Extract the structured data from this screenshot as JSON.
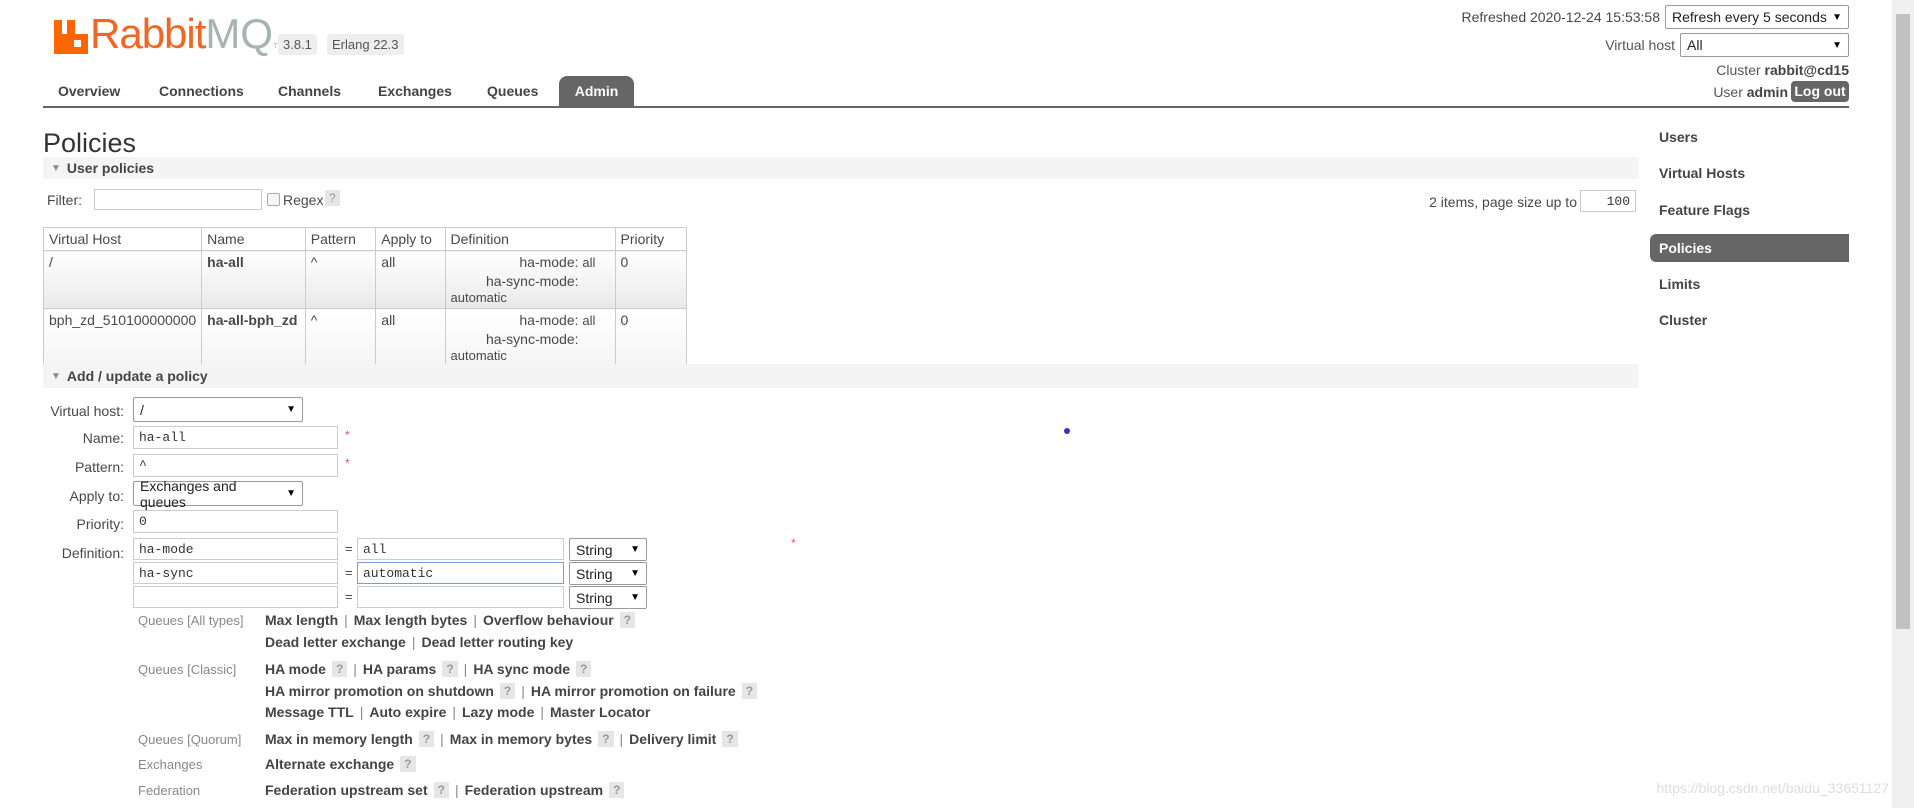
{
  "header": {
    "logo_text": "RabbitMQ",
    "version": "3.8.1",
    "erlang": "Erlang 22.3",
    "refreshed": "Refreshed 2020-12-24 15:53:58",
    "refresh_select": "Refresh every 5 seconds",
    "vhost_label": "Virtual host",
    "vhost_select": "All",
    "cluster_label": "Cluster",
    "cluster_name": "rabbit@cd15",
    "user_label": "User",
    "user_name": "admin",
    "logout": "Log out"
  },
  "tabs": [
    "Overview",
    "Connections",
    "Channels",
    "Exchanges",
    "Queues",
    "Admin"
  ],
  "active_tab": "Admin",
  "page_title": "Policies",
  "user_policies": {
    "title": "User policies",
    "filter_label": "Filter:",
    "filter_value": "",
    "regex_label": "Regex",
    "help": "?",
    "items_text": "2 items, page size up to",
    "page_size": "100",
    "columns": [
      "Virtual Host",
      "Name",
      "Pattern",
      "Apply to",
      "Definition",
      "Priority"
    ],
    "rows": [
      {
        "vhost": "/",
        "name": "ha-all",
        "pattern": "^",
        "apply_to": "all",
        "def": [
          [
            "ha-mode:",
            "all"
          ],
          [
            "ha-sync-mode:",
            "automatic"
          ]
        ],
        "priority": "0"
      },
      {
        "vhost": "bph_zd_510100000000",
        "name": "ha-all-bph_zd",
        "pattern": "^",
        "apply_to": "all",
        "def": [
          [
            "ha-mode:",
            "all"
          ],
          [
            "ha-sync-mode:",
            "automatic"
          ]
        ],
        "priority": "0"
      }
    ]
  },
  "form": {
    "title": "Add / update a policy",
    "vhost_label": "Virtual host:",
    "vhost_value": "/",
    "name_label": "Name:",
    "name_value": "ha-all",
    "pattern_label": "Pattern:",
    "pattern_value": "^",
    "apply_label": "Apply to:",
    "apply_value": "Exchanges and queues",
    "priority_label": "Priority:",
    "priority_value": "0",
    "definition_label": "Definition:",
    "required": "*",
    "eq": "=",
    "defs": [
      {
        "key": "ha-mode",
        "value": "all",
        "type": "String"
      },
      {
        "key": "ha-sync",
        "value": "automatic",
        "type": "String"
      },
      {
        "key": "",
        "value": "",
        "type": "String"
      }
    ],
    "help_groups": [
      {
        "label": "Queues [All types]",
        "lines": [
          [
            [
              "Max length",
              false
            ],
            [
              "Max length bytes",
              false
            ],
            [
              "Overflow behaviour",
              true
            ]
          ],
          [
            [
              "Dead letter exchange",
              false
            ],
            [
              "Dead letter routing key",
              false
            ]
          ]
        ]
      },
      {
        "label": "Queues [Classic]",
        "lines": [
          [
            [
              "HA mode",
              true
            ],
            [
              "HA params",
              true
            ],
            [
              "HA sync mode",
              true
            ]
          ],
          [
            [
              "HA mirror promotion on shutdown",
              true
            ],
            [
              "HA mirror promotion on failure",
              true
            ]
          ],
          [
            [
              "Message TTL",
              false
            ],
            [
              "Auto expire",
              false
            ],
            [
              "Lazy mode",
              false
            ],
            [
              "Master Locator",
              false
            ]
          ]
        ]
      },
      {
        "label": "Queues [Quorum]",
        "lines": [
          [
            [
              "Max in memory length",
              true
            ],
            [
              "Max in memory bytes",
              true
            ],
            [
              "Delivery limit",
              true
            ]
          ]
        ]
      },
      {
        "label": "Exchanges",
        "lines": [
          [
            [
              "Alternate exchange",
              true
            ]
          ]
        ]
      },
      {
        "label": "Federation",
        "lines": [
          [
            [
              "Federation upstream set",
              true
            ],
            [
              "Federation upstream",
              true
            ]
          ]
        ]
      }
    ]
  },
  "sidebar": [
    "Users",
    "Virtual Hosts",
    "Feature Flags",
    "Policies",
    "Limits",
    "Cluster"
  ],
  "sidebar_active": "Policies",
  "watermark": "https://blog.csdn.net/baidu_33651127",
  "colors": {
    "brand": "#f26522",
    "tab_active": "#666666"
  }
}
